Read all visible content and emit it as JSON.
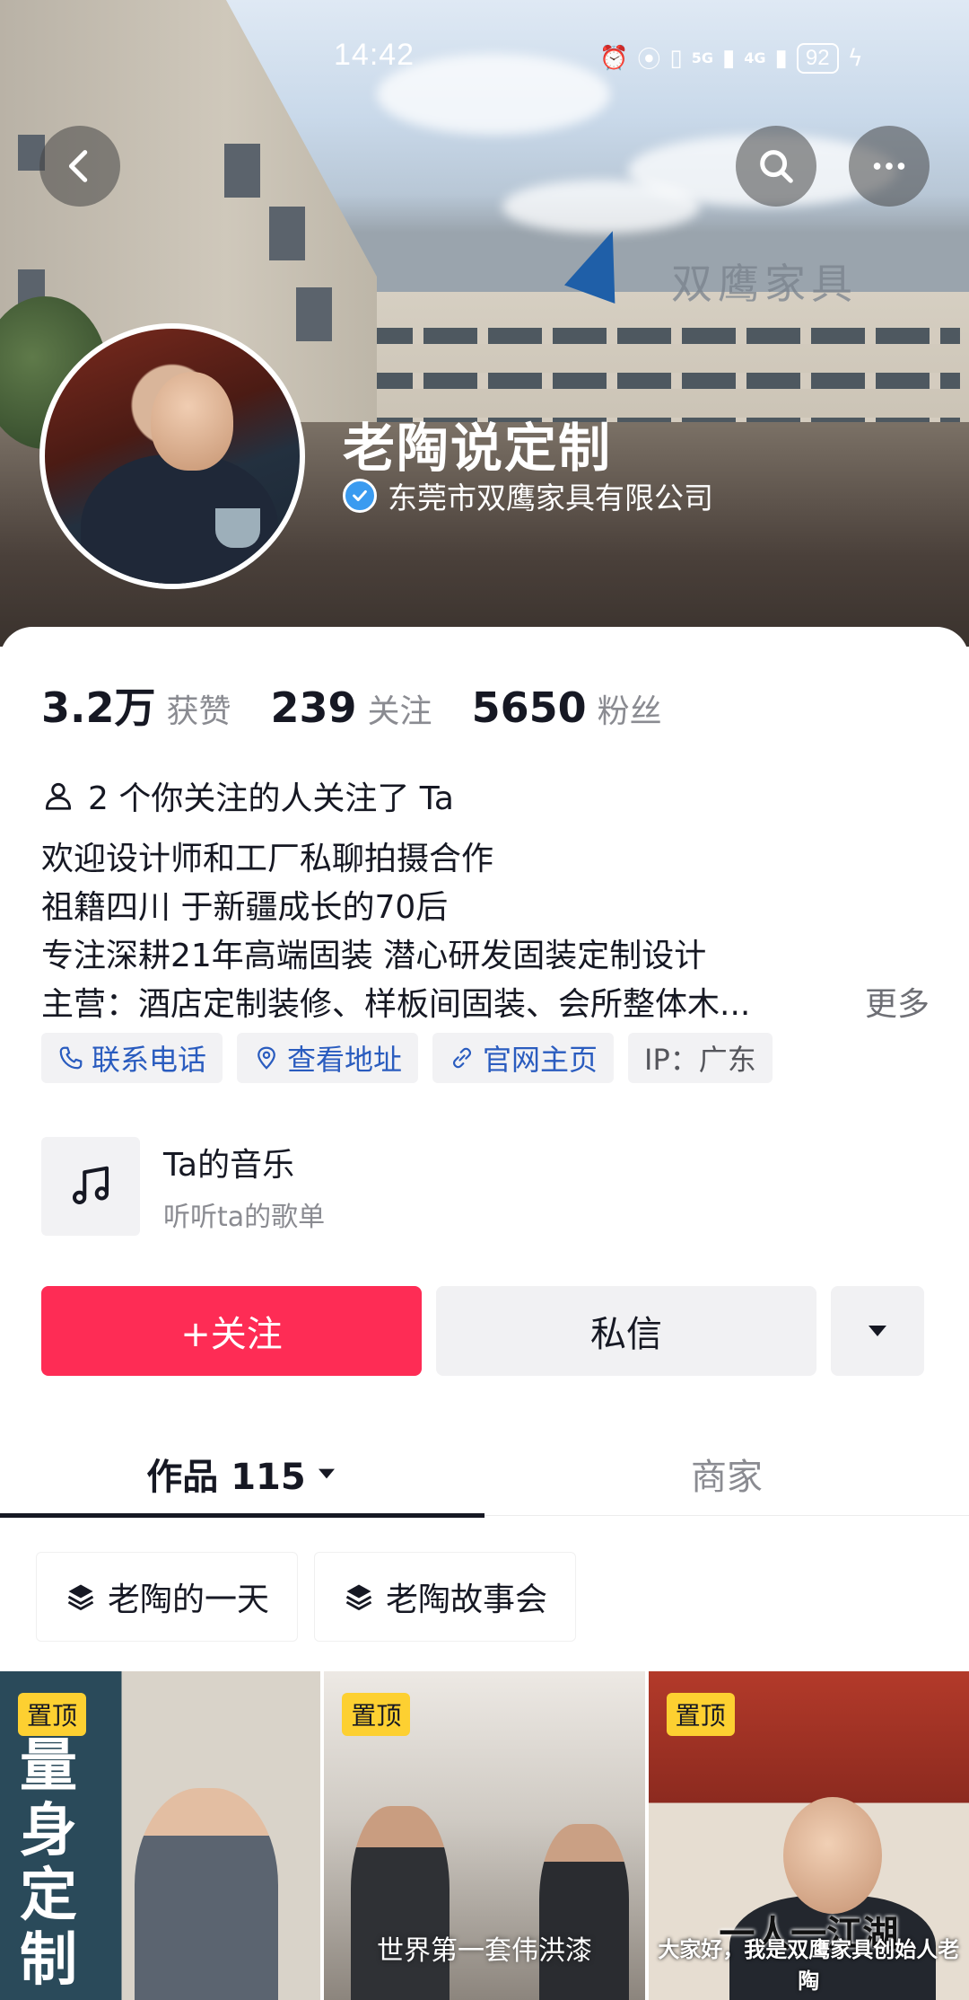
{
  "status_bar": {
    "time": "14:42",
    "signal_5g": "5G",
    "signal_4g": "4G",
    "battery": "92"
  },
  "header": {
    "cover_sign": "双鹰家具",
    "name": "老陶说定制",
    "verified_company": "东莞市双鹰家具有限公司"
  },
  "stats": [
    {
      "value": "3.2万",
      "label": "获赞"
    },
    {
      "value": "239",
      "label": "关注"
    },
    {
      "value": "5650",
      "label": "粉丝"
    }
  ],
  "mutual": "2 个你关注的人关注了 Ta",
  "bio": {
    "lines": [
      "欢迎设计师和工厂私聊拍摄合作",
      "祖籍四川 于新疆成长的70后",
      "专注深耕21年高端固装 潜心研发固装定制设计",
      "主营：酒店定制装修、样板间固装、会所整体木..."
    ],
    "more": "更多"
  },
  "tags": {
    "phone": "联系电话",
    "address": "查看地址",
    "website": "官网主页",
    "ip": "IP：广东"
  },
  "music": {
    "title": "Ta的音乐",
    "subtitle": "听听ta的歌单"
  },
  "actions": {
    "follow": "+关注",
    "message": "私信"
  },
  "tabs": {
    "works": "作品 115",
    "shop": "商家"
  },
  "collections": [
    "老陶的一天",
    "老陶故事会"
  ],
  "videos": [
    {
      "pin": "置顶",
      "overlay": "量身定制"
    },
    {
      "pin": "置顶",
      "caption": "世界第一套伟洪漆"
    },
    {
      "pin": "置顶",
      "banner": "一人一江湖",
      "subtitle": "大家好，我是双鹰家具创始人老陶"
    }
  ]
}
